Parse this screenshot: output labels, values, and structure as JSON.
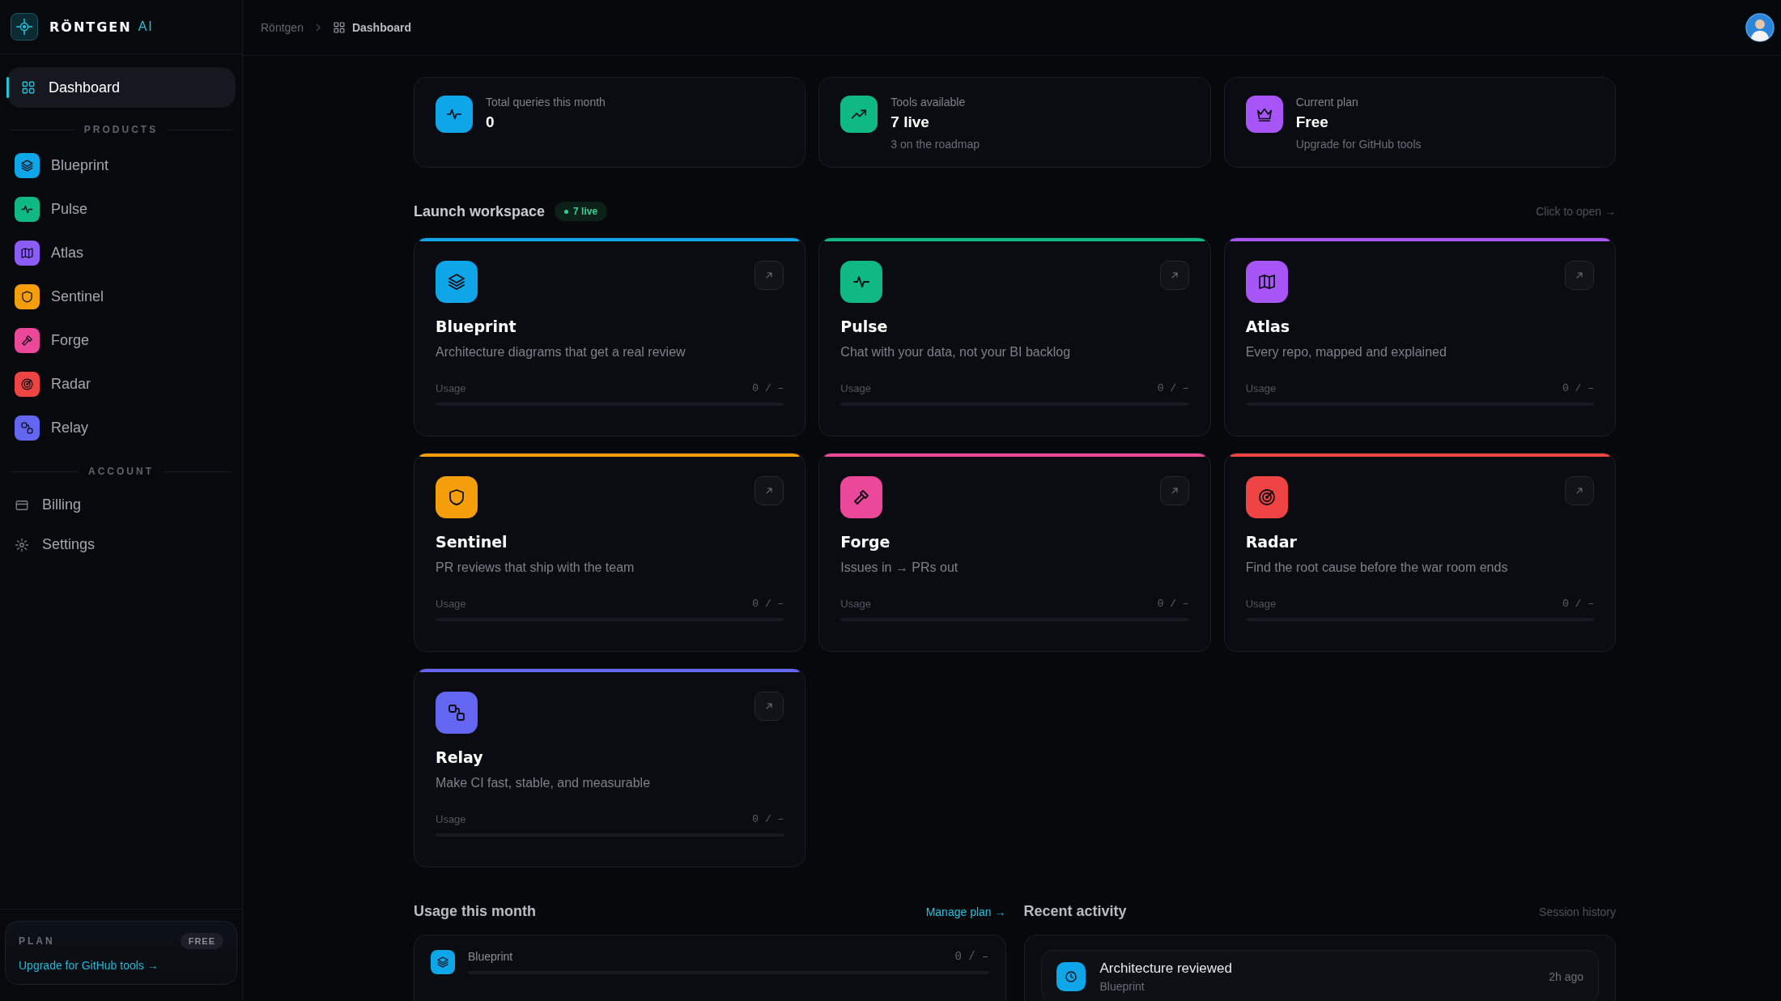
{
  "brand": {
    "name": "RÖNTGEN",
    "suffix": "AI"
  },
  "breadcrumb": [
    {
      "label": "Röntgen"
    },
    {
      "label": "Dashboard"
    }
  ],
  "sidebar": {
    "dashboard": {
      "label": "Dashboard",
      "selected": true
    },
    "products_heading": "PRODUCTS",
    "products": [
      {
        "label": "Blueprint",
        "color": "#0ea5e9",
        "selected": false
      },
      {
        "label": "Pulse",
        "color": "#10b981",
        "selected": false
      },
      {
        "label": "Atlas",
        "color": "#8b5cf6",
        "selected": false
      },
      {
        "label": "Sentinel",
        "color": "#f59e0b",
        "selected": false
      },
      {
        "label": "Forge",
        "color": "#ec4899",
        "selected": false
      },
      {
        "label": "Radar",
        "color": "#ef4444",
        "selected": false
      },
      {
        "label": "Relay",
        "color": "#6366f1",
        "selected": false
      }
    ],
    "account_heading": "ACCOUNT",
    "account": [
      {
        "label": "Billing",
        "selected": false
      },
      {
        "label": "Settings",
        "selected": false
      }
    ],
    "plan": {
      "label": "PLAN",
      "badge": "FREE",
      "link": "Upgrade for GitHub tools →"
    }
  },
  "stats": [
    {
      "label": "Total queries this month",
      "value": "0",
      "color": "#0ea5e9"
    },
    {
      "label": "Tools available",
      "value": "7 live",
      "note": "3 on the roadmap",
      "color": "#10b981"
    },
    {
      "label": "Current plan",
      "value": "Free",
      "note": "Upgrade for GitHub tools",
      "color": "#a855f7"
    }
  ],
  "workspace": {
    "title": "Launch workspace",
    "badge": "7 live",
    "hint": "Click to open →",
    "cards": [
      {
        "name": "Blueprint",
        "description": "Architecture diagrams that get a real review",
        "color": "#0ea5e9",
        "usage_label": "Usage",
        "usage": "0 / –",
        "level": 0
      },
      {
        "name": "Pulse",
        "description": "Chat with your data, not your BI backlog",
        "color": "#10b981",
        "usage_label": "Usage",
        "usage": "0 / –",
        "level": 0
      },
      {
        "name": "Atlas",
        "description": "Every repo, mapped and explained",
        "color": "#a855f7",
        "usage_label": "Usage",
        "usage": "0 / –",
        "level": 0
      },
      {
        "name": "Sentinel",
        "description": "PR reviews that ship with the team",
        "color": "#f59e0b",
        "usage_label": "Usage",
        "usage": "0 / –",
        "level": 0
      },
      {
        "name": "Forge",
        "description": "Issues in → PRs out",
        "color": "#ec4899",
        "usage_label": "Usage",
        "usage": "0 / –",
        "level": 0
      },
      {
        "name": "Radar",
        "description": "Find the root cause before the war room ends",
        "color": "#ef4444",
        "usage_label": "Usage",
        "usage": "0 / –",
        "level": 0
      },
      {
        "name": "Relay",
        "description": "Make CI fast, stable, and measurable",
        "color": "#6366f1",
        "usage_label": "Usage",
        "usage": "0 / –",
        "level": 0
      }
    ]
  },
  "usage": {
    "title": "Usage this month",
    "link": "Manage plan →",
    "rows": [
      {
        "name": "Blueprint",
        "reading": "0 / –",
        "level": 0,
        "color": "#0ea5e9"
      }
    ]
  },
  "activity": {
    "title": "Recent activity",
    "link": "Session history",
    "items": [
      {
        "title": "Architecture reviewed",
        "subtitle": "Blueprint",
        "time": "2h ago",
        "color": "#0ea5e9"
      }
    ]
  }
}
